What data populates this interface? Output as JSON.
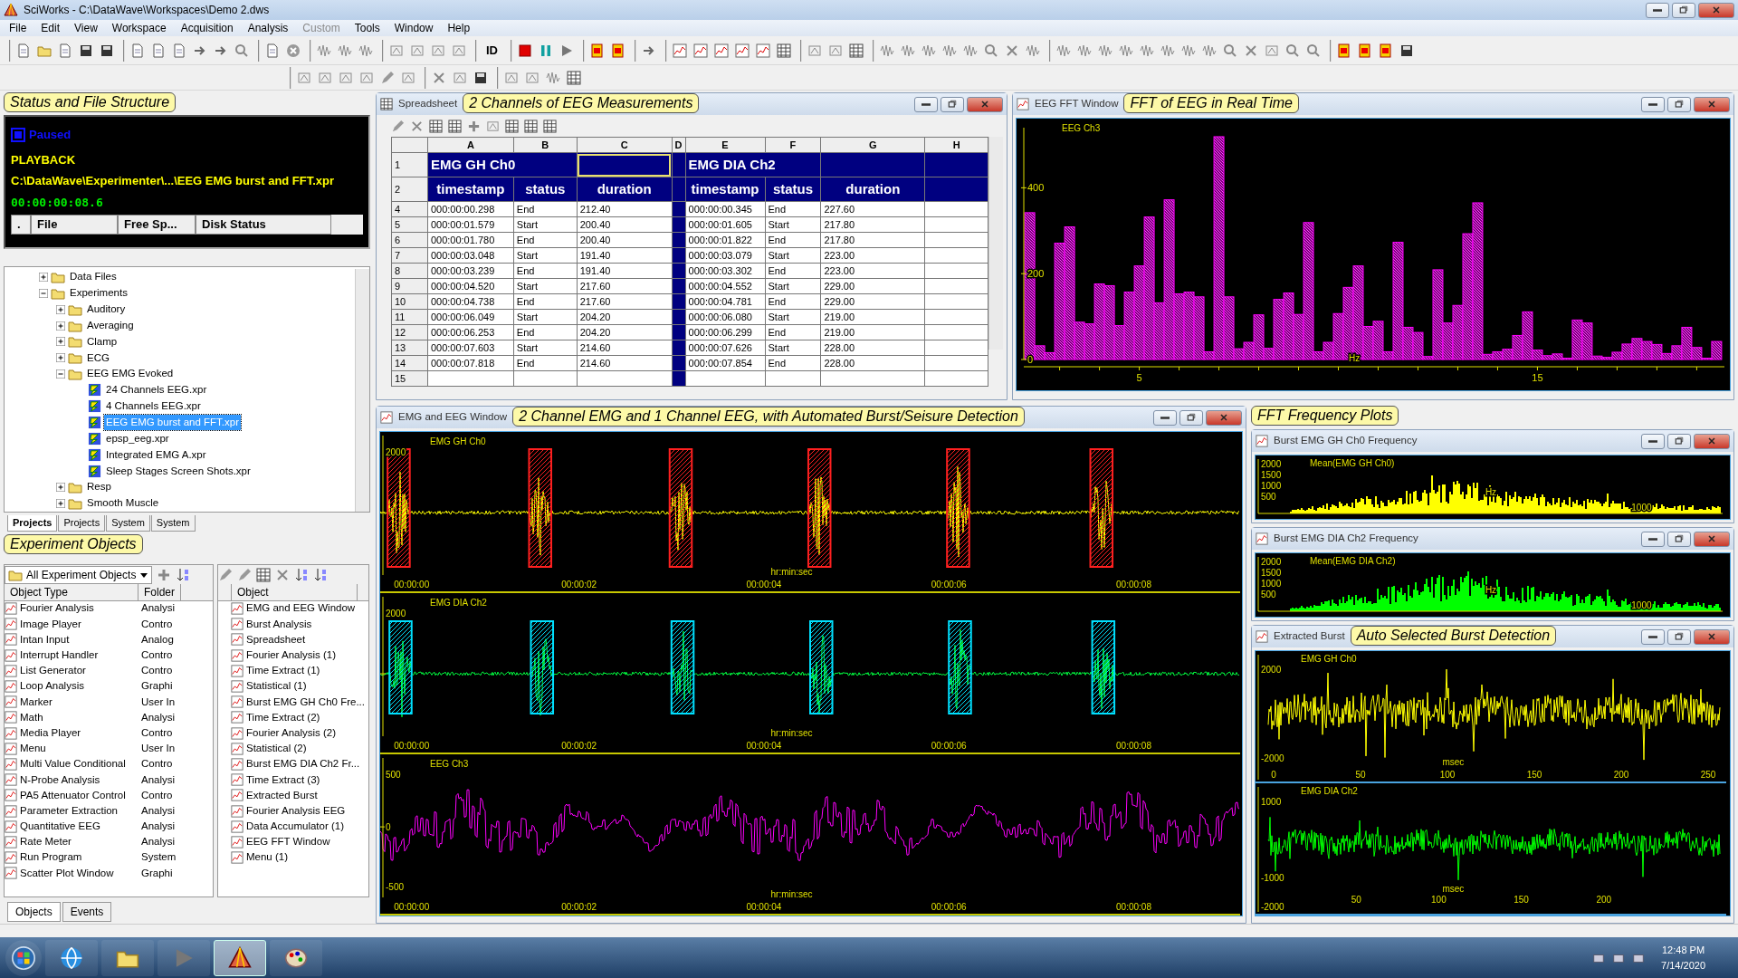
{
  "window": {
    "title": "SciWorks - C:\\DataWave\\Workspaces\\Demo 2.dws"
  },
  "menu": [
    {
      "label": "File",
      "disabled": false
    },
    {
      "label": "Edit",
      "disabled": false
    },
    {
      "label": "View",
      "disabled": false
    },
    {
      "label": "Workspace",
      "disabled": false
    },
    {
      "label": "Acquisition",
      "disabled": false
    },
    {
      "label": "Analysis",
      "disabled": false
    },
    {
      "label": "Custom",
      "disabled": true
    },
    {
      "label": "Tools",
      "disabled": false
    },
    {
      "label": "Window",
      "disabled": false
    },
    {
      "label": "Help",
      "disabled": false
    }
  ],
  "toolbar": {
    "id_label": "ID"
  },
  "status_panel": {
    "callout": "Status and File Structure",
    "state": "Paused",
    "mode": "PLAYBACK",
    "path": "C:\\DataWave\\Experimenter\\...\\EEG EMG burst and FFT.xpr",
    "time": "00:00:00:08.6",
    "columns": [
      ".",
      "File",
      "Free Sp...",
      "Disk Status"
    ]
  },
  "file_tree": {
    "items": [
      {
        "label": "Data Files",
        "kind": "folder",
        "expanded": false,
        "selected": false
      },
      {
        "label": "Experiments",
        "kind": "folder",
        "expanded": true,
        "selected": false,
        "children": [
          {
            "label": "Auditory",
            "kind": "folder",
            "expanded": false,
            "selected": false
          },
          {
            "label": "Averaging",
            "kind": "folder",
            "expanded": false,
            "selected": false
          },
          {
            "label": "Clamp",
            "kind": "folder",
            "expanded": false,
            "selected": false
          },
          {
            "label": "ECG",
            "kind": "folder",
            "expanded": false,
            "selected": false
          },
          {
            "label": "EEG EMG Evoked",
            "kind": "folder",
            "expanded": true,
            "selected": false,
            "children": [
              {
                "label": "24 Channels EEG.xpr",
                "kind": "file",
                "selected": false
              },
              {
                "label": "4 Channels EEG.xpr",
                "kind": "file",
                "selected": false
              },
              {
                "label": "EEG EMG burst and FFT.xpr",
                "kind": "file",
                "selected": true
              },
              {
                "label": "epsp_eeg.xpr",
                "kind": "file",
                "selected": false
              },
              {
                "label": "Integrated EMG A.xpr",
                "kind": "file",
                "selected": false
              },
              {
                "label": "Sleep Stages Screen Shots.xpr",
                "kind": "file",
                "selected": false
              }
            ]
          },
          {
            "label": "Resp",
            "kind": "folder",
            "expanded": false,
            "selected": false
          },
          {
            "label": "Smooth Muscle",
            "kind": "folder",
            "expanded": false,
            "selected": false
          }
        ]
      }
    ],
    "tabs": [
      {
        "label": "Projects",
        "selected": true
      },
      {
        "label": "Projects",
        "selected": false
      },
      {
        "label": "System",
        "selected": false
      },
      {
        "label": "System",
        "selected": false
      }
    ]
  },
  "objects_panel": {
    "callout": "Experiment Objects",
    "filter": "All Experiment Objects",
    "type_columns": [
      "Object Type",
      "Folder"
    ],
    "types": [
      {
        "name": "Fourier Analysis",
        "folder": "Analysi"
      },
      {
        "name": "Image Player",
        "folder": "Contro"
      },
      {
        "name": "Intan Input",
        "folder": "Analog"
      },
      {
        "name": "Interrupt Handler",
        "folder": "Contro"
      },
      {
        "name": "List Generator",
        "folder": "Contro"
      },
      {
        "name": "Loop Analysis",
        "folder": "Graphi"
      },
      {
        "name": "Marker",
        "folder": "User In"
      },
      {
        "name": "Math",
        "folder": "Analysi"
      },
      {
        "name": "Media Player",
        "folder": "Contro"
      },
      {
        "name": "Menu",
        "folder": "User In"
      },
      {
        "name": "Multi Value Conditional",
        "folder": "Contro"
      },
      {
        "name": "N-Probe Analysis",
        "folder": "Analysi"
      },
      {
        "name": "PA5 Attenuator Control",
        "folder": "Contro"
      },
      {
        "name": "Parameter Extraction",
        "folder": "Analysi"
      },
      {
        "name": "Quantitative EEG",
        "folder": "Analysi"
      },
      {
        "name": "Rate Meter",
        "folder": "Analysi"
      },
      {
        "name": "Run Program",
        "folder": "System"
      },
      {
        "name": "Scatter Plot Window",
        "folder": "Graphi"
      }
    ],
    "object_column": "Object",
    "objects": [
      "EMG and EEG Window",
      "Burst Analysis",
      "Spreadsheet",
      "Fourier Analysis (1)",
      "Time Extract (1)",
      "Statistical (1)",
      "Burst EMG GH Ch0 Fre...",
      "Time Extract (2)",
      "Fourier Analysis (2)",
      "Statistical (2)",
      "Burst EMG DIA Ch2 Fr...",
      "Time Extract (3)",
      "Extracted Burst",
      "Fourier Analysis EEG",
      "Data Accumulator (1)",
      "EEG FFT Window",
      "Menu (1)"
    ],
    "tabs": [
      {
        "label": "Objects",
        "selected": true
      },
      {
        "label": "Events",
        "selected": false
      }
    ]
  },
  "spreadsheet": {
    "title": "Spreadsheet",
    "callout": "2 Channels of EEG Measurements",
    "columns": [
      "A",
      "B",
      "C",
      "D",
      "E",
      "F",
      "G",
      "H"
    ],
    "header_rows": [
      "1",
      "2"
    ],
    "channels": [
      {
        "name": "EMG GH Ch0",
        "fields": [
          "timestamp",
          "status",
          "duration"
        ]
      },
      {
        "name": "EMG DIA Ch2",
        "fields": [
          "timestamp",
          "status",
          "duration"
        ]
      }
    ],
    "rows": [
      {
        "num": "4",
        "cells": [
          "000:00:00.298",
          "End",
          "212.40",
          "",
          "000:00:00.345",
          "End",
          "227.60"
        ]
      },
      {
        "num": "5",
        "cells": [
          "000:00:01.579",
          "Start",
          "200.40",
          "",
          "000:00:01.605",
          "Start",
          "217.80"
        ]
      },
      {
        "num": "6",
        "cells": [
          "000:00:01.780",
          "End",
          "200.40",
          "",
          "000:00:01.822",
          "End",
          "217.80"
        ]
      },
      {
        "num": "7",
        "cells": [
          "000:00:03.048",
          "Start",
          "191.40",
          "",
          "000:00:03.079",
          "Start",
          "223.00"
        ]
      },
      {
        "num": "8",
        "cells": [
          "000:00:03.239",
          "End",
          "191.40",
          "",
          "000:00:03.302",
          "End",
          "223.00"
        ]
      },
      {
        "num": "9",
        "cells": [
          "000:00:04.520",
          "Start",
          "217.60",
          "",
          "000:00:04.552",
          "Start",
          "229.00"
        ]
      },
      {
        "num": "10",
        "cells": [
          "000:00:04.738",
          "End",
          "217.60",
          "",
          "000:00:04.781",
          "End",
          "229.00"
        ]
      },
      {
        "num": "11",
        "cells": [
          "000:00:06.049",
          "Start",
          "204.20",
          "",
          "000:00:06.080",
          "Start",
          "219.00"
        ]
      },
      {
        "num": "12",
        "cells": [
          "000:00:06.253",
          "End",
          "204.20",
          "",
          "000:00:06.299",
          "End",
          "219.00"
        ]
      },
      {
        "num": "13",
        "cells": [
          "000:00:07.603",
          "Start",
          "214.60",
          "",
          "000:00:07.626",
          "Start",
          "228.00"
        ]
      },
      {
        "num": "14",
        "cells": [
          "000:00:07.818",
          "End",
          "214.60",
          "",
          "000:00:07.854",
          "End",
          "228.00"
        ]
      }
    ],
    "last_row": "15"
  },
  "fft_window": {
    "title": "EEG FFT Window",
    "callout": "FFT of EEG in Real Time",
    "chart_data": {
      "type": "bar",
      "title": "EEG Ch3",
      "xlabel": "Hz",
      "x": [
        2.25,
        2.5,
        2.75,
        3,
        3.25,
        3.5,
        3.75,
        4,
        4.25,
        4.5,
        4.75,
        5,
        5.25,
        5.5,
        5.75,
        6,
        6.25,
        6.5,
        6.75,
        7,
        7.25,
        7.5,
        7.75,
        8,
        8.25,
        8.5,
        8.75,
        9,
        9.25,
        9.5,
        9.75,
        10,
        10.25,
        10.5,
        10.75,
        11,
        11.25,
        11.5,
        11.75,
        12,
        12.25,
        12.5,
        12.75,
        13,
        13.25,
        13.5,
        13.75,
        14,
        14.25,
        14.5,
        14.75,
        15,
        15.25,
        15.5,
        15.75,
        16,
        16.25,
        16.5,
        16.75,
        17,
        17.25,
        17.5,
        17.75,
        18,
        18.25,
        18.5,
        18.75,
        19,
        19.25,
        19.5
      ],
      "values": [
        342,
        32,
        16,
        271,
        309,
        87,
        83,
        176,
        172,
        79,
        157,
        218,
        332,
        132,
        372,
        153,
        157,
        146,
        18,
        519,
        146,
        25,
        40,
        104,
        26,
        140,
        155,
        105,
        319,
        18,
        40,
        107,
        168,
        218,
        77,
        89,
        18,
        273,
        75,
        63,
        7,
        209,
        85,
        126,
        293,
        365,
        12,
        18,
        24,
        56,
        111,
        22,
        9,
        13,
        3,
        92,
        85,
        8,
        5,
        17,
        36,
        49,
        42,
        35,
        14,
        32,
        75,
        28,
        3,
        42
      ],
      "xlim": [
        2.1,
        19.65
      ],
      "ylim": [
        0,
        540
      ],
      "xticks": [
        5,
        15
      ],
      "yticks": [
        0,
        200,
        400
      ]
    }
  },
  "emg_window": {
    "title": "EMG and EEG Window",
    "callout": "2 Channel EMG and 1 Channel EEG, with Automated Burst/Seisure Detection",
    "plots": [
      {
        "label": "EMG GH Ch0",
        "kind": "emg",
        "color": "#ffff00",
        "marker": {
          "color": "#ff2020"
        },
        "yticks": [
          "2000"
        ],
        "xticks": [
          "00:00:00",
          "00:00:02",
          "00:00:04",
          "00:00:06",
          "00:00:08"
        ],
        "xlabel": "hr:min:sec"
      },
      {
        "label": "EMG DIA Ch2",
        "kind": "emg",
        "color": "#00ff40",
        "marker": {
          "color": "#00e0ff"
        },
        "yticks": [
          "2000"
        ],
        "xticks": [
          "00:00:00",
          "00:00:02",
          "00:00:04",
          "00:00:06",
          "00:00:08"
        ],
        "xlabel": "hr:min:sec"
      },
      {
        "label": "EEG Ch3",
        "kind": "eeg",
        "color": "#ff00ff",
        "yticks": [
          "500",
          "0",
          "-500"
        ],
        "xticks": [
          "00:00:00",
          "00:00:02",
          "00:00:04",
          "00:00:06",
          "00:00:08"
        ],
        "xlabel": "hr:min:sec"
      }
    ]
  },
  "freq_plots": {
    "callout": "FFT Frequency Plots",
    "windows": [
      {
        "title": "Burst EMG GH Ch0 Frequency",
        "series": "Mean(EMG GH Ch0)",
        "color": "#ffff00",
        "yticks": [
          "2000",
          "1500",
          "1000",
          "500"
        ],
        "xticks": [
          "1000"
        ],
        "xlabel": "Hz"
      },
      {
        "title": "Burst EMG DIA Ch2 Frequency",
        "series": "Mean(EMG DIA Ch2)",
        "color": "#00ff00",
        "yticks": [
          "2000",
          "1500",
          "1000",
          "500"
        ],
        "xticks": [
          "1000"
        ],
        "xlabel": "Hz"
      }
    ]
  },
  "extracted": {
    "title": "Extracted Burst",
    "callout": "Auto Selected Burst Detection",
    "plots": [
      {
        "label": "EMG GH Ch0",
        "color": "#ffff00",
        "yticks": [
          "2000",
          "-2000"
        ],
        "xticks": [
          "0",
          "50",
          "100",
          "150",
          "200",
          "250"
        ],
        "xlabel": "msec"
      },
      {
        "label": "EMG DIA Ch2",
        "color": "#00ff00",
        "yticks": [
          "1000",
          "-1000",
          "-2000"
        ],
        "xticks": [
          "50",
          "100",
          "150",
          "200"
        ],
        "xlabel": "msec"
      }
    ]
  },
  "taskbar": {
    "apps": [
      {
        "selected": false
      },
      {
        "selected": false
      },
      {
        "selected": false
      },
      {
        "selected": true
      },
      {
        "selected": false
      }
    ],
    "clock": "12:48 PM",
    "date": "7/14/2020"
  }
}
